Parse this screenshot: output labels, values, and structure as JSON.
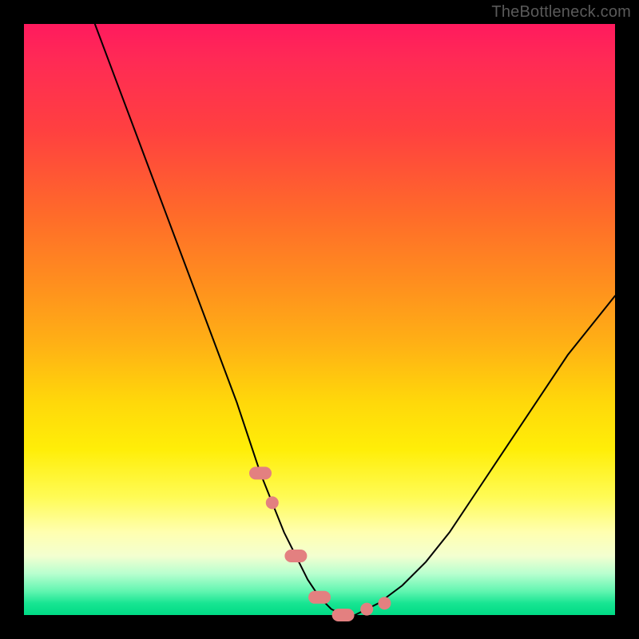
{
  "watermark": "TheBottleneck.com",
  "chart_data": {
    "type": "line",
    "title": "",
    "xlabel": "",
    "ylabel": "",
    "xlim": [
      0,
      100
    ],
    "ylim": [
      0,
      100
    ],
    "series": [
      {
        "name": "bottleneck-curve",
        "x": [
          12,
          15,
          18,
          21,
          24,
          27,
          30,
          33,
          36,
          38,
          40,
          42,
          44,
          46,
          48,
          50,
          52,
          54,
          56,
          58,
          60,
          64,
          68,
          72,
          76,
          80,
          84,
          88,
          92,
          96,
          100
        ],
        "values": [
          100,
          92,
          84,
          76,
          68,
          60,
          52,
          44,
          36,
          30,
          24,
          19,
          14,
          10,
          6,
          3,
          1,
          0,
          0,
          1,
          2,
          5,
          9,
          14,
          20,
          26,
          32,
          38,
          44,
          49,
          54
        ]
      }
    ],
    "markers": {
      "name": "highlight-dots",
      "x": [
        40,
        42,
        46,
        50,
        54,
        58,
        61
      ],
      "values": [
        24,
        19,
        10,
        3,
        0,
        1,
        2
      ],
      "shape": [
        "pill",
        "dot",
        "pill",
        "pill",
        "pill",
        "dot",
        "dot"
      ]
    },
    "colors": {
      "curve": "#000000",
      "marker": "#e38080",
      "background_top": "#ff1a5e",
      "background_mid": "#ffee08",
      "background_bottom": "#00db85"
    }
  }
}
